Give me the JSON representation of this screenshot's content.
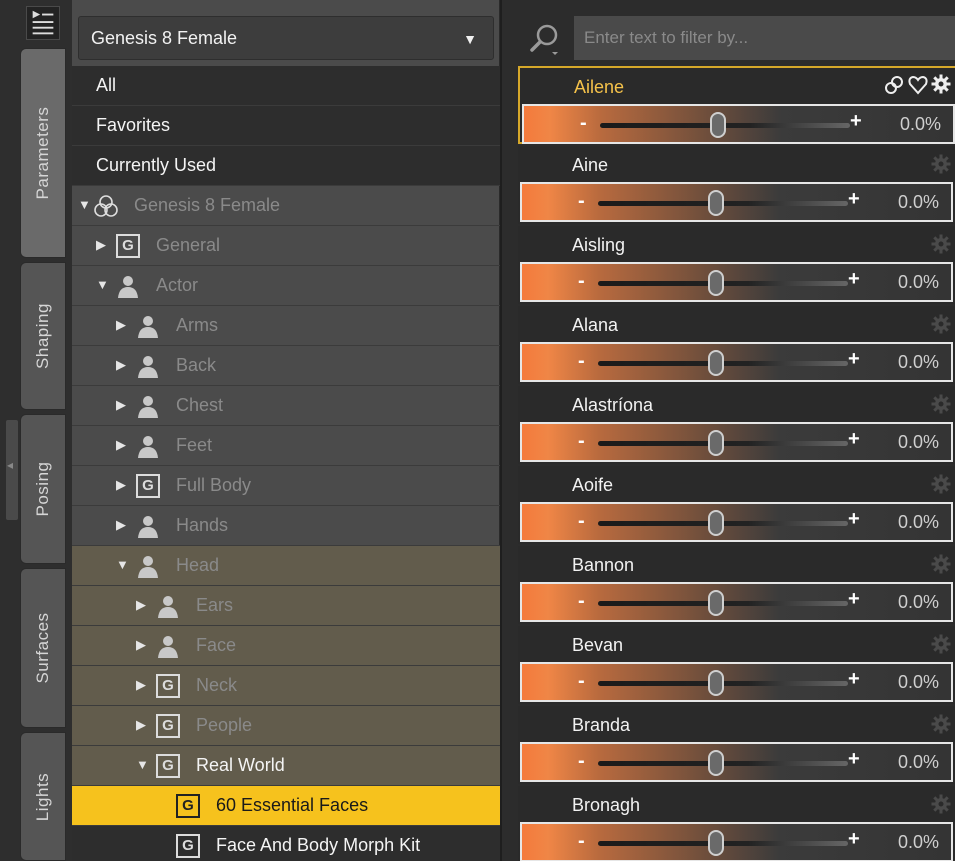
{
  "tabs": [
    {
      "label": "Parameters",
      "active": true
    },
    {
      "label": "Shaping",
      "active": false
    },
    {
      "label": "Posing",
      "active": false
    },
    {
      "label": "Surfaces",
      "active": false
    },
    {
      "label": "Lights",
      "active": false
    }
  ],
  "figure_select": {
    "value": "Genesis 8 Female"
  },
  "tree": {
    "all": "All",
    "favorites": "Favorites",
    "currently_used": "Currently Used",
    "root": "Genesis 8 Female",
    "general": "General",
    "actor": "Actor",
    "arms": "Arms",
    "back": "Back",
    "chest": "Chest",
    "feet": "Feet",
    "full_body": "Full Body",
    "hands": "Hands",
    "head": "Head",
    "ears": "Ears",
    "face": "Face",
    "neck": "Neck",
    "people": "People",
    "real_world": "Real World",
    "essential_faces": "60 Essential Faces",
    "morph_kit": "Face And Body Morph Kit",
    "group_icon_letter": "G"
  },
  "filter": {
    "placeholder": "Enter text to filter by..."
  },
  "slider_labels": {
    "minus": "-",
    "plus": "+"
  },
  "params": [
    {
      "name": "Ailene",
      "value": "0.0%"
    },
    {
      "name": "Aine",
      "value": "0.0%"
    },
    {
      "name": "Aisling",
      "value": "0.0%"
    },
    {
      "name": "Alana",
      "value": "0.0%"
    },
    {
      "name": "Alastríona",
      "value": "0.0%"
    },
    {
      "name": "Aoife",
      "value": "0.0%"
    },
    {
      "name": "Bannon",
      "value": "0.0%"
    },
    {
      "name": "Bevan",
      "value": "0.0%"
    },
    {
      "name": "Branda",
      "value": "0.0%"
    },
    {
      "name": "Bronagh",
      "value": "0.0%"
    }
  ],
  "colors": {
    "accent": "#f6c21d",
    "slider_fill": "#f47a3c",
    "selected_border": "#d6a82a"
  }
}
